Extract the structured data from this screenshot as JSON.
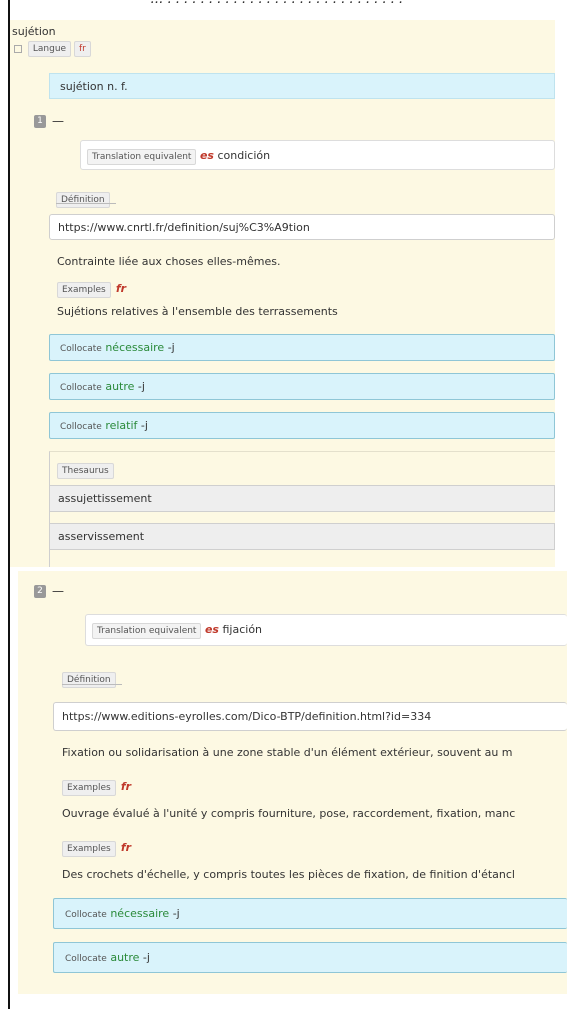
{
  "entry": {
    "headword": "sujétion",
    "lang_label": "Langue",
    "lang_code": "fr",
    "lemma": "sujétion n. f."
  },
  "sense1": {
    "number": "1",
    "dash": "—",
    "translation_label": "Translation equivalent",
    "translation_lang": "es",
    "translation_text": "condición",
    "definition_label": "Définition",
    "definition_url": "https://www.cnrtl.fr/definition/suj%C3%A9tion",
    "definition_text": "Contrainte liée aux choses elles-mêmes.",
    "examples_label": "Examples",
    "examples_lang": "fr",
    "example_text": "Sujétions relatives à l'ensemble des terrassements",
    "collocates": [
      {
        "label": "Collocate",
        "word": "nécessaire",
        "suffix": "-j"
      },
      {
        "label": "Collocate",
        "word": "autre",
        "suffix": "-j"
      },
      {
        "label": "Collocate",
        "word": "relatif",
        "suffix": "-j"
      }
    ],
    "thesaurus_label": "Thesaurus",
    "thesaurus_items": [
      "assujettissement",
      "asservissement"
    ]
  },
  "sense2": {
    "number": "2",
    "dash": "—",
    "translation_label": "Translation equivalent",
    "translation_lang": "es",
    "translation_text": "fijación",
    "definition_label": "Définition",
    "definition_url": "https://www.editions-eyrolles.com/Dico-BTP/definition.html?id=334",
    "definition_text": "Fixation ou solidarisation à une zone stable d'un élément extérieur, souvent au m",
    "examples": [
      {
        "label": "Examples",
        "lang": "fr",
        "text": "Ouvrage évalué à l'unité y compris fourniture, pose, raccordement, fixation, manc"
      },
      {
        "label": "Examples",
        "lang": "fr",
        "text": "Des crochets d'échelle, y compris toutes les pièces de fixation, de finition d'étancl"
      }
    ],
    "collocates": [
      {
        "label": "Collocate",
        "word": "nécessaire",
        "suffix": "-j"
      },
      {
        "label": "Collocate",
        "word": "autre",
        "suffix": "-j"
      }
    ]
  },
  "colors": {
    "cream": "#fdf9e3",
    "blue": "#d9f3fb",
    "green": "#2a8a3a",
    "red": "#c0392b"
  }
}
